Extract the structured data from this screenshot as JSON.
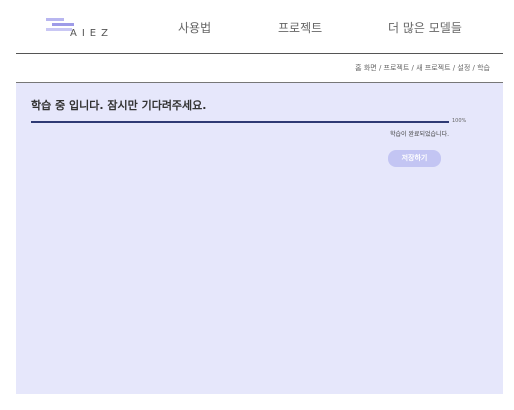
{
  "header": {
    "logo_text": "AIEZ",
    "nav": [
      "사용법",
      "프로젝트",
      "더 많은 모델들"
    ]
  },
  "breadcrumb": [
    "홈 화면",
    "프로젝트",
    "새 프로젝트",
    "설정",
    "학습"
  ],
  "panel": {
    "title": "학습 중 입니다. 잠시만 기다려주세요.",
    "progress_percent": 100,
    "progress_label": "100%",
    "status_message": "학습이 완료되었습니다.",
    "save_button_label": "저장하기"
  },
  "colors": {
    "panel_bg": "#e6e7fb",
    "progress_fill": "#2f3a74",
    "button_bg": "#c3c5f3",
    "logo_accent": "#9e9be8"
  }
}
